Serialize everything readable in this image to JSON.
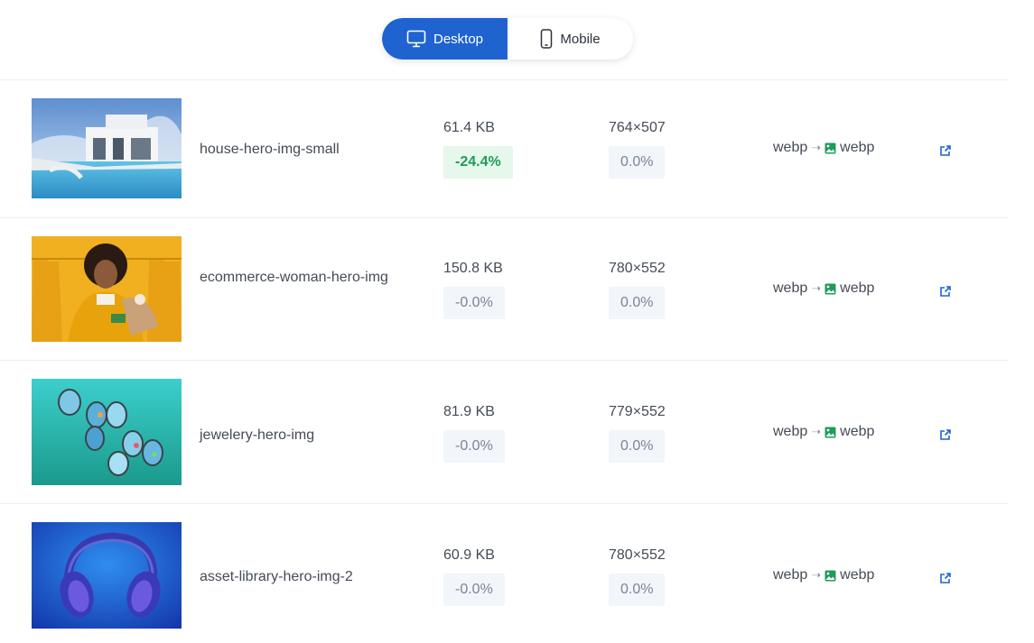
{
  "toggle": {
    "desktop_label": "Desktop",
    "mobile_label": "Mobile",
    "active": "desktop"
  },
  "rows": [
    {
      "name": "house-hero-img-small",
      "size": "61.4 KB",
      "size_change": "-24.4%",
      "dimensions": "764×507",
      "dim_change": "0.0%",
      "from_format": "webp",
      "to_format": "webp",
      "thumbnail": "house-pool-photo"
    },
    {
      "name": "ecommerce-woman-hero-img",
      "size": "150.8 KB",
      "size_change": "-0.0%",
      "dimensions": "780×552",
      "dim_change": "0.0%",
      "from_format": "webp",
      "to_format": "webp",
      "thumbnail": "woman-yellow-photo"
    },
    {
      "name": "jewelery-hero-img",
      "size": "81.9 KB",
      "size_change": "-0.0%",
      "dimensions": "779×552",
      "dim_change": "0.0%",
      "from_format": "webp",
      "to_format": "webp",
      "thumbnail": "opal-jewelry-photo"
    },
    {
      "name": "asset-library-hero-img-2",
      "size": "60.9 KB",
      "size_change": "-0.0%",
      "dimensions": "780×552",
      "dim_change": "0.0%",
      "from_format": "webp",
      "to_format": "webp",
      "thumbnail": "blue-headphones-photo"
    }
  ],
  "colors": {
    "accent": "#1f63d0",
    "good": "#1f9b5a",
    "good_bg": "#e6f7ec",
    "neutral_bg": "#f2f5fa"
  }
}
